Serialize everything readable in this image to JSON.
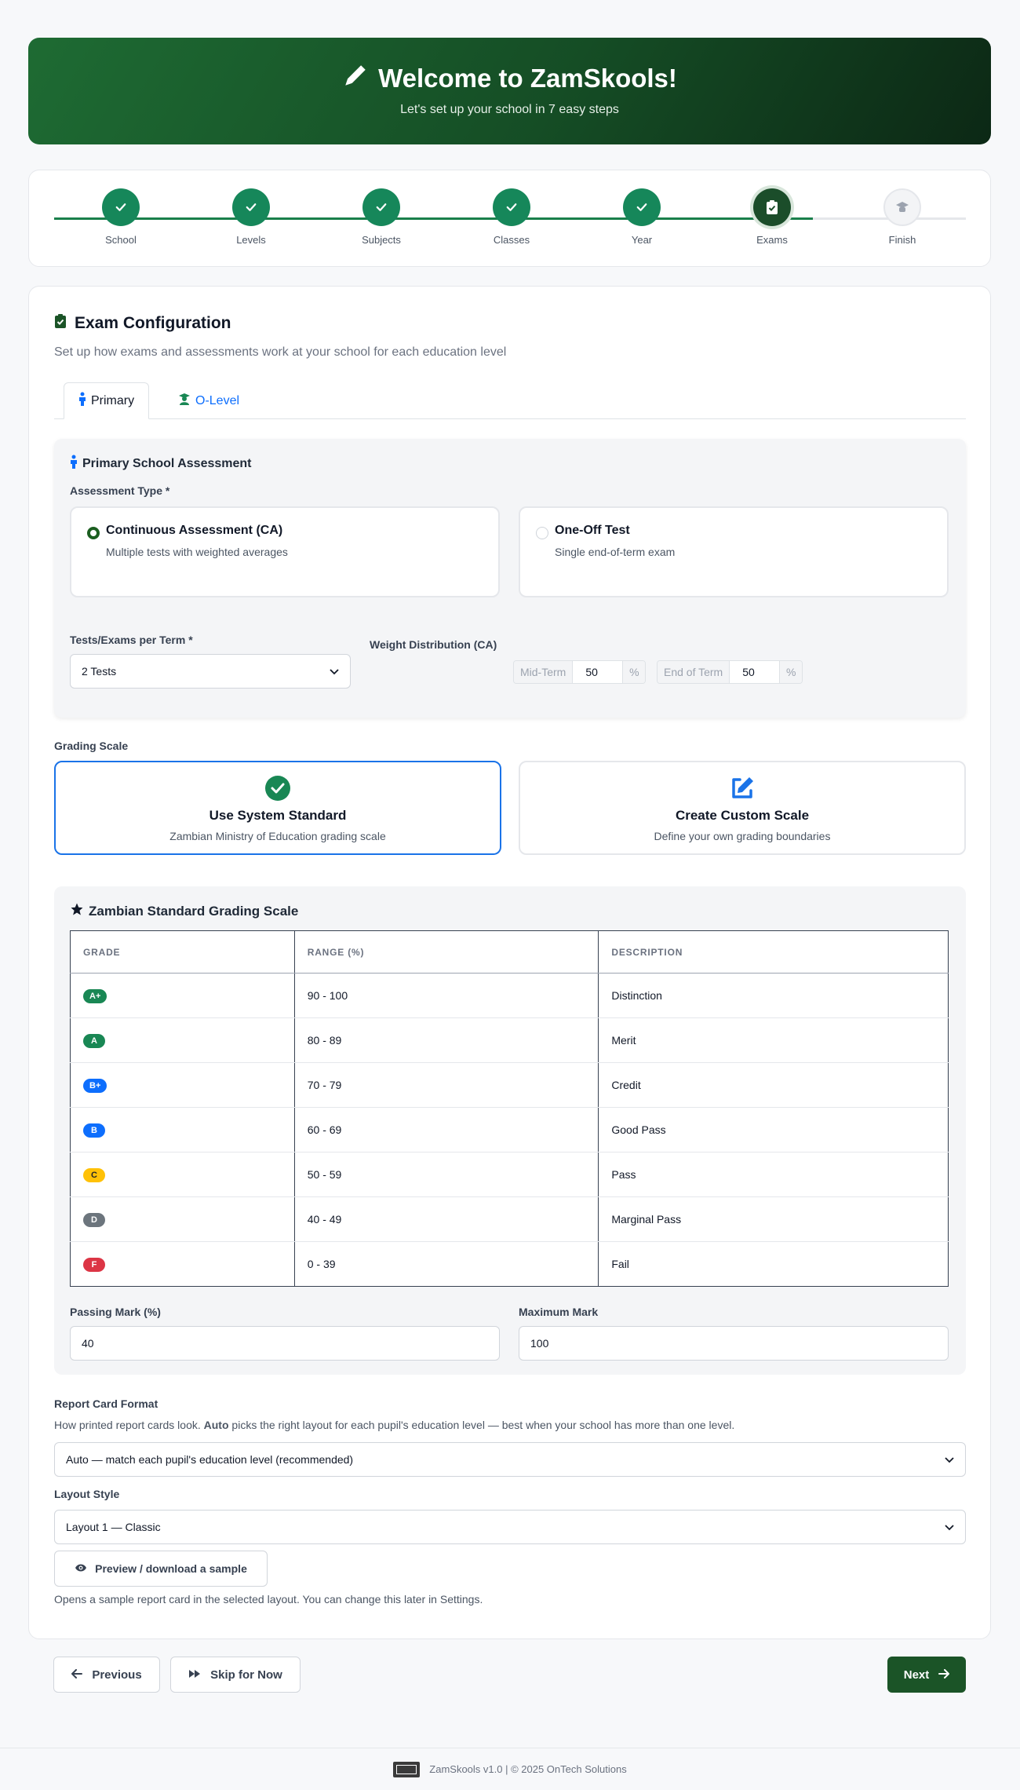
{
  "header": {
    "title": "Welcome to ZamSkools!",
    "subtitle": "Let's set up your school in 7 easy steps"
  },
  "steps": [
    {
      "label": "School",
      "status": "done"
    },
    {
      "label": "Levels",
      "status": "done"
    },
    {
      "label": "Subjects",
      "status": "done"
    },
    {
      "label": "Classes",
      "status": "done"
    },
    {
      "label": "Year",
      "status": "done"
    },
    {
      "label": "Exams",
      "status": "active"
    },
    {
      "label": "Finish",
      "status": "pending"
    }
  ],
  "section": {
    "title": "Exam Configuration",
    "subtitle": "Set up how exams and assessments work at your school for each education level"
  },
  "tabs": [
    {
      "label": "Primary",
      "active": true
    },
    {
      "label": "O-Level",
      "active": false
    }
  ],
  "assessment": {
    "title": "Primary School Assessment",
    "type_label": "Assessment Type *",
    "options": [
      {
        "title": "Continuous Assessment (CA)",
        "desc": "Multiple tests with weighted averages",
        "selected": true
      },
      {
        "title": "One-Off Test",
        "desc": "Single end-of-term exam",
        "selected": false
      }
    ],
    "tests_label": "Tests/Exams per Term *",
    "tests_value": "2 Tests",
    "weight_label": "Weight Distribution (CA)",
    "weights": [
      {
        "label": "Mid-Term",
        "value": "50",
        "unit": "%"
      },
      {
        "label": "End of Term",
        "value": "50",
        "unit": "%"
      }
    ]
  },
  "grading": {
    "label": "Grading Scale",
    "options": [
      {
        "title": "Use System Standard",
        "desc": "Zambian Ministry of Education grading scale",
        "selected": true
      },
      {
        "title": "Create Custom Scale",
        "desc": "Define your own grading boundaries",
        "selected": false
      }
    ],
    "scale_title": "Zambian Standard Grading Scale",
    "columns": [
      "GRADE",
      "RANGE (%)",
      "DESCRIPTION"
    ],
    "rows": [
      {
        "grade": "A+",
        "range": "90 - 100",
        "desc": "Distinction",
        "color": "#198754",
        "text": "#ffffff"
      },
      {
        "grade": "A",
        "range": "80 - 89",
        "desc": "Merit",
        "color": "#198754",
        "text": "#ffffff"
      },
      {
        "grade": "B+",
        "range": "70 - 79",
        "desc": "Credit",
        "color": "#0d6efd",
        "text": "#ffffff"
      },
      {
        "grade": "B",
        "range": "60 - 69",
        "desc": "Good Pass",
        "color": "#0d6efd",
        "text": "#ffffff"
      },
      {
        "grade": "C",
        "range": "50 - 59",
        "desc": "Pass",
        "color": "#ffc107",
        "text": "#212529"
      },
      {
        "grade": "D",
        "range": "40 - 49",
        "desc": "Marginal Pass",
        "color": "#6c757d",
        "text": "#ffffff"
      },
      {
        "grade": "F",
        "range": "0 - 39",
        "desc": "Fail",
        "color": "#dc3545",
        "text": "#ffffff"
      }
    ],
    "passing_label": "Passing Mark (%)",
    "passing_value": "40",
    "max_label": "Maximum Mark",
    "max_value": "100"
  },
  "report": {
    "label": "Report Card Format",
    "help_pre": "How printed report cards look. ",
    "help_bold": "Auto",
    "help_post": " picks the right layout for each pupil's education level — best when your school has more than one level.",
    "format_value": "Auto — match each pupil's education level (recommended)",
    "layout_label": "Layout Style",
    "layout_value": "Layout 1 — Classic",
    "preview_label": "Preview / download a sample",
    "hint": "Opens a sample report card in the selected layout. You can change this later in Settings."
  },
  "nav": {
    "previous": "Previous",
    "skip": "Skip for Now",
    "next": "Next"
  },
  "footer": {
    "text": "ZamSkools v1.0 | © 2025 OnTech Solutions"
  },
  "colors": {
    "brand": "#1b5427",
    "success": "#16875a",
    "primary": "#0d6efd"
  }
}
